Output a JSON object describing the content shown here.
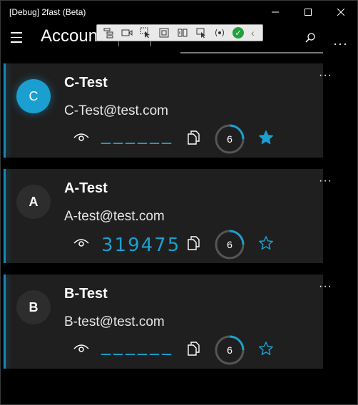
{
  "window": {
    "title": "[Debug] 2fast (Beta)",
    "minimize": "minimize",
    "maximize": "maximize",
    "close": "close"
  },
  "appbar": {
    "title": "Accounts",
    "search_placeholder": "",
    "more": "···"
  },
  "colors": {
    "accent": "#1a9fd0",
    "card_bg": "#1f1f1f",
    "background": "#000000"
  },
  "accounts": [
    {
      "initial": "C",
      "name": "C-Test",
      "email": "C-Test@test.com",
      "code": "______",
      "code_visible": false,
      "timer": "6",
      "timer_progress": 0.25,
      "favorite": true,
      "menu": "···",
      "selected": true
    },
    {
      "initial": "A",
      "name": "A-Test",
      "email": "A-test@test.com",
      "code": "319475",
      "code_visible": true,
      "timer": "6",
      "timer_progress": 0.25,
      "favorite": false,
      "menu": "···",
      "selected": false
    },
    {
      "initial": "B",
      "name": "B-Test",
      "email": "B-test@test.com",
      "code": "______",
      "code_visible": false,
      "timer": "6",
      "timer_progress": 0.25,
      "favorite": false,
      "menu": "···",
      "selected": false
    }
  ]
}
